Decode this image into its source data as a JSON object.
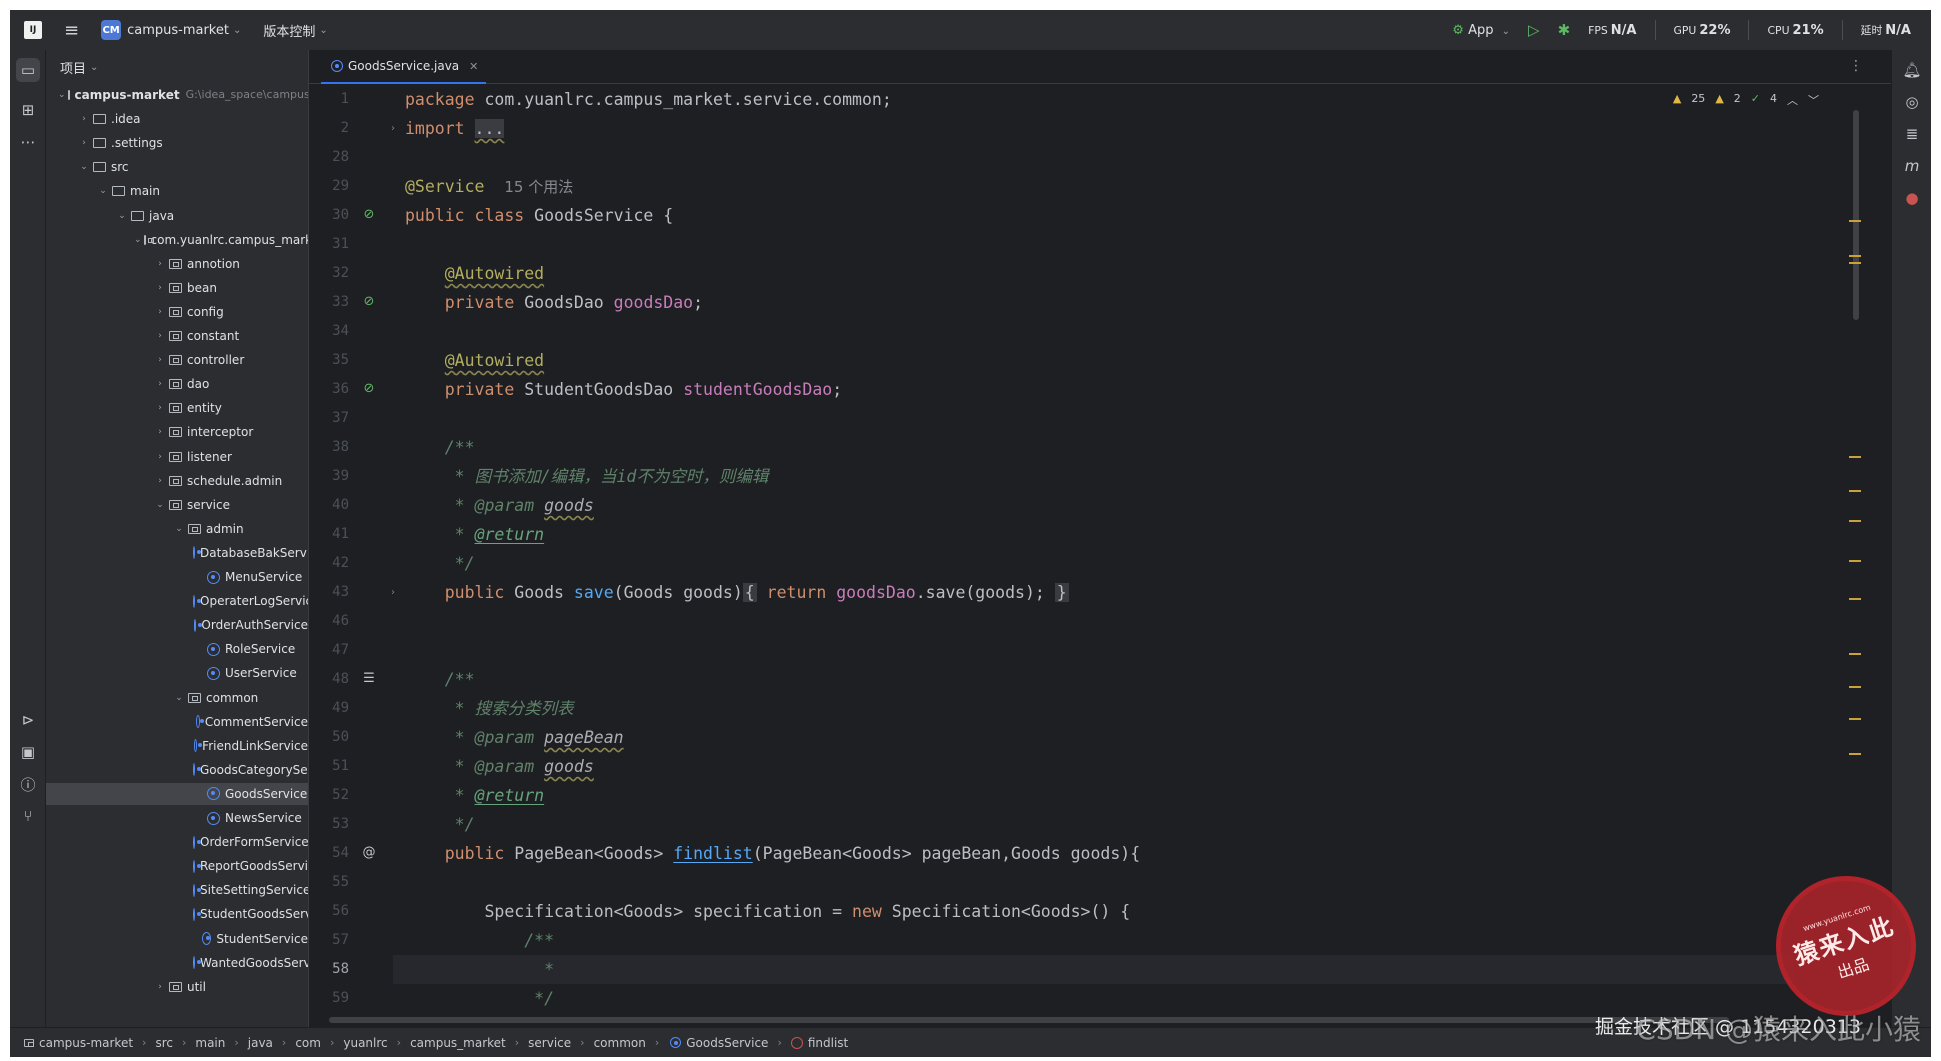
{
  "titlebar": {
    "project_badge": "CM",
    "project_name": "campus-market",
    "vcs_label": "版本控制",
    "run_config": "App",
    "fps_label": "FPS",
    "fps_value": "N/A",
    "gpu_label": "GPU",
    "gpu_value": "22%",
    "cpu_label": "CPU",
    "cpu_value": "21%",
    "time_label": "延时",
    "time_value": "N/A"
  },
  "project_panel": {
    "header": "项目",
    "root_name": "campus-market",
    "root_path": "G:\\idea_space\\campus-market",
    "items": [
      {
        "label": "campus-market",
        "level": 0,
        "kind": "module",
        "expanded": true
      },
      {
        "label": ".idea",
        "level": 1,
        "kind": "folder",
        "expanded": false
      },
      {
        "label": ".settings",
        "level": 1,
        "kind": "folder",
        "expanded": false
      },
      {
        "label": "src",
        "level": 1,
        "kind": "folder",
        "expanded": true
      },
      {
        "label": "main",
        "level": 2,
        "kind": "folder",
        "expanded": true
      },
      {
        "label": "java",
        "level": 3,
        "kind": "folder",
        "expanded": true
      },
      {
        "label": "com.yuanlrc.campus_market",
        "level": 4,
        "kind": "package",
        "expanded": true
      },
      {
        "label": "annotion",
        "level": 5,
        "kind": "package",
        "expanded": false
      },
      {
        "label": "bean",
        "level": 5,
        "kind": "package",
        "expanded": false
      },
      {
        "label": "config",
        "level": 5,
        "kind": "package",
        "expanded": false
      },
      {
        "label": "constant",
        "level": 5,
        "kind": "package",
        "expanded": false
      },
      {
        "label": "controller",
        "level": 5,
        "kind": "package",
        "expanded": false
      },
      {
        "label": "dao",
        "level": 5,
        "kind": "package",
        "expanded": false
      },
      {
        "label": "entity",
        "level": 5,
        "kind": "package",
        "expanded": false
      },
      {
        "label": "interceptor",
        "level": 5,
        "kind": "package",
        "expanded": false
      },
      {
        "label": "listener",
        "level": 5,
        "kind": "package",
        "expanded": false
      },
      {
        "label": "schedule.admin",
        "level": 5,
        "kind": "package",
        "expanded": false
      },
      {
        "label": "service",
        "level": 5,
        "kind": "package",
        "expanded": true
      },
      {
        "label": "admin",
        "level": 6,
        "kind": "package",
        "expanded": true
      },
      {
        "label": "DatabaseBakService",
        "level": 7,
        "kind": "class"
      },
      {
        "label": "MenuService",
        "level": 7,
        "kind": "class"
      },
      {
        "label": "OperaterLogService",
        "level": 7,
        "kind": "class"
      },
      {
        "label": "OrderAuthService",
        "level": 7,
        "kind": "class"
      },
      {
        "label": "RoleService",
        "level": 7,
        "kind": "class"
      },
      {
        "label": "UserService",
        "level": 7,
        "kind": "class"
      },
      {
        "label": "common",
        "level": 6,
        "kind": "package",
        "expanded": true
      },
      {
        "label": "CommentService",
        "level": 7,
        "kind": "class"
      },
      {
        "label": "FriendLinkService",
        "level": 7,
        "kind": "class"
      },
      {
        "label": "GoodsCategoryService",
        "level": 7,
        "kind": "class"
      },
      {
        "label": "GoodsService",
        "level": 7,
        "kind": "class",
        "selected": true
      },
      {
        "label": "NewsService",
        "level": 7,
        "kind": "class"
      },
      {
        "label": "OrderFormService",
        "level": 7,
        "kind": "class"
      },
      {
        "label": "ReportGoodsService",
        "level": 7,
        "kind": "class"
      },
      {
        "label": "SiteSettingService",
        "level": 7,
        "kind": "class"
      },
      {
        "label": "StudentGoodsService",
        "level": 7,
        "kind": "class"
      },
      {
        "label": "StudentService",
        "level": 7,
        "kind": "class"
      },
      {
        "label": "WantedGoodsService",
        "level": 7,
        "kind": "class"
      },
      {
        "label": "util",
        "level": 5,
        "kind": "package",
        "expanded": false
      }
    ]
  },
  "editor": {
    "tab_label": "GoodsService.java",
    "inspections": {
      "warnings": "25",
      "weak_warnings": "2",
      "ok": "4"
    },
    "line_numbers": [
      "1",
      "2",
      "28",
      "29",
      "30",
      "31",
      "32",
      "33",
      "34",
      "35",
      "36",
      "37",
      "38",
      "39",
      "40",
      "41",
      "42",
      "43",
      "46",
      "47",
      "48",
      "49",
      "50",
      "51",
      "52",
      "53",
      "54",
      "55",
      "56",
      "57",
      "58",
      "59"
    ],
    "current_line": "58",
    "code": {
      "package_kw": "package",
      "package_name": " com.yuanlrc.campus_market.service.common;",
      "import_kw": "import",
      "import_dots": "...",
      "service_ann": "@Service",
      "usages_hint": "15 个用法",
      "class_decl_kw": "public class",
      "class_decl_rest": " GoodsService {",
      "autowired": "@Autowired",
      "private_kw": "private",
      "goods_dao_type": " GoodsDao ",
      "goods_dao_field": "goodsDao",
      "student_dao_type": " StudentGoodsDao ",
      "student_dao_field": "studentGoodsDao",
      "semicolon": ";",
      "doc_open": "/**",
      "doc_star": " * ",
      "doc_close": " */",
      "doc_save_desc": "图书添加/编辑，当id不为空时，则编辑",
      "param_tag": "@param",
      "return_tag": "@return",
      "goods_param": "goods",
      "pagebean_param": "pageBean",
      "public_kw": "public",
      "save_ret_type": " Goods ",
      "save_name": "save",
      "save_params": "(Goods goods)",
      "return_kw": "return",
      "save_body_rest": ".save(goods);",
      "brace_open": "{",
      "brace_close": "}",
      "doc_findlist_desc": "搜索分类列表",
      "findlist_ret_type": " PageBean<Goods> ",
      "findlist_name": "findlist",
      "findlist_params": "(PageBean<Goods> pageBean,Goods goods){",
      "spec_decl": "Specification<Goods> specification = ",
      "new_kw": "new",
      "spec_rest": " Specification<Goods>() {",
      "inner_doc_open": "/**",
      "inner_doc_star": "*",
      "inner_doc_close": "*/"
    }
  },
  "statusbar": {
    "breadcrumbs": [
      "campus-market",
      "src",
      "main",
      "java",
      "com",
      "yuanlrc",
      "campus_market",
      "service",
      "common",
      "GoodsService",
      "findlist"
    ]
  },
  "watermarks": {
    "stamp_url": "www.yuanlrc.com",
    "stamp_main": "猿来入此",
    "stamp_sub": "出品",
    "juejin": "掘金技术社区 @ 1154320313",
    "csdn": "CSDN @猿来入此小猿"
  },
  "colors": {
    "keyword": "#cf8e6d",
    "annotation": "#b3ae60",
    "field": "#c77dbb",
    "method": "#56a8f5",
    "doc_comment": "#5f826b",
    "accent": "#3574f0",
    "stamp_red": "#b0232a"
  }
}
